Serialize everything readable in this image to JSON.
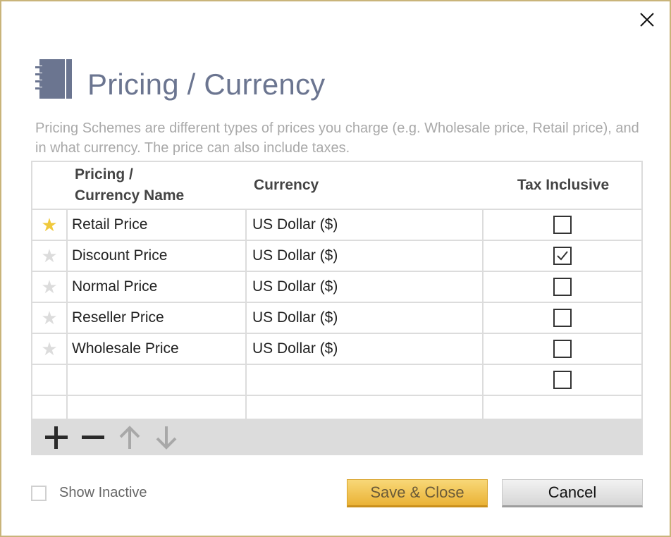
{
  "dialog": {
    "title": "Pricing / Currency",
    "description": "Pricing Schemes are different types of prices you charge (e.g. Wholesale price, Retail price), and in what currency. The price can also include taxes.",
    "title_icon": "notebook-icon",
    "close_icon": "close-icon"
  },
  "table": {
    "headers": {
      "name_line1": "Pricing /",
      "name_line2": "Currency Name",
      "currency": "Currency",
      "tax_inclusive": "Tax Inclusive"
    },
    "rows": [
      {
        "default": true,
        "name": "Retail Price",
        "currency": "US Dollar ($)",
        "tax_inclusive": false
      },
      {
        "default": false,
        "name": "Discount Price",
        "currency": "US Dollar ($)",
        "tax_inclusive": true
      },
      {
        "default": false,
        "name": "Normal Price",
        "currency": "US Dollar ($)",
        "tax_inclusive": false
      },
      {
        "default": false,
        "name": "Reseller Price",
        "currency": "US Dollar ($)",
        "tax_inclusive": false
      },
      {
        "default": false,
        "name": "Wholesale Price",
        "currency": "US Dollar ($)",
        "tax_inclusive": false
      },
      {
        "default": false,
        "name": "",
        "currency": "",
        "tax_inclusive": false,
        "new_row": true
      }
    ]
  },
  "toolbar": {
    "icons": [
      "plus-icon",
      "minus-icon",
      "arrow-up-icon",
      "arrow-down-icon"
    ]
  },
  "footer": {
    "show_inactive_label": "Show Inactive",
    "show_inactive_checked": false,
    "save_label": "Save & Close",
    "cancel_label": "Cancel"
  },
  "colors": {
    "accent": "#eab236",
    "title": "#6b7590",
    "star_on": "#f0c93c",
    "star_off": "#dcdcdc"
  }
}
